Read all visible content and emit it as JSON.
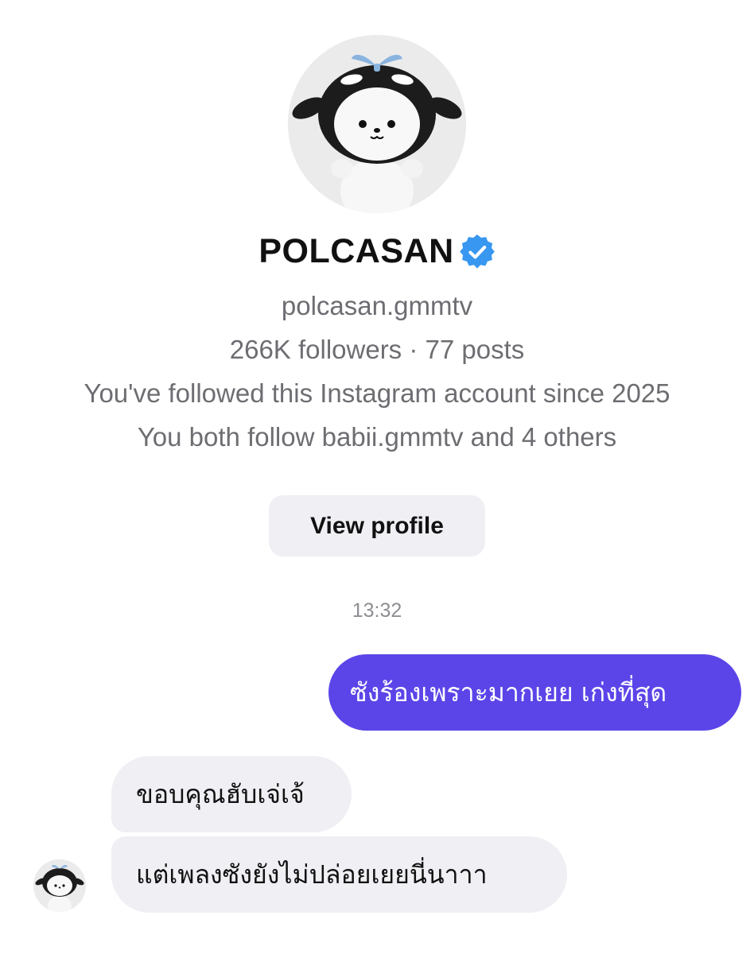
{
  "profile": {
    "display_name": "POLCASAN",
    "verified": true,
    "handle": "polcasan.gmmtv",
    "stats": "266K followers · 77 posts",
    "followed_since": "You've followed this Instagram account since 2025",
    "mutual": "You both follow babii.gmmtv and 4 others",
    "view_profile_label": "View profile",
    "avatar_icon": "orca-plush-avatar"
  },
  "chat": {
    "timestamp": "13:32",
    "messages": [
      {
        "direction": "outgoing",
        "text": "ซังร้องเพราะมากเยย เก่งที่สุด"
      },
      {
        "direction": "incoming",
        "text": "ขอบคุณฮับเจ่เจ้"
      },
      {
        "direction": "incoming",
        "text": "แต่เพลงซังยังไม่ปล่อยเยยนี่นาาา"
      }
    ]
  },
  "colors": {
    "outgoing_bubble": "#5b45e8",
    "incoming_bubble": "#efeff4",
    "verified_badge": "#3897f0",
    "secondary_text": "#6d6d72"
  }
}
